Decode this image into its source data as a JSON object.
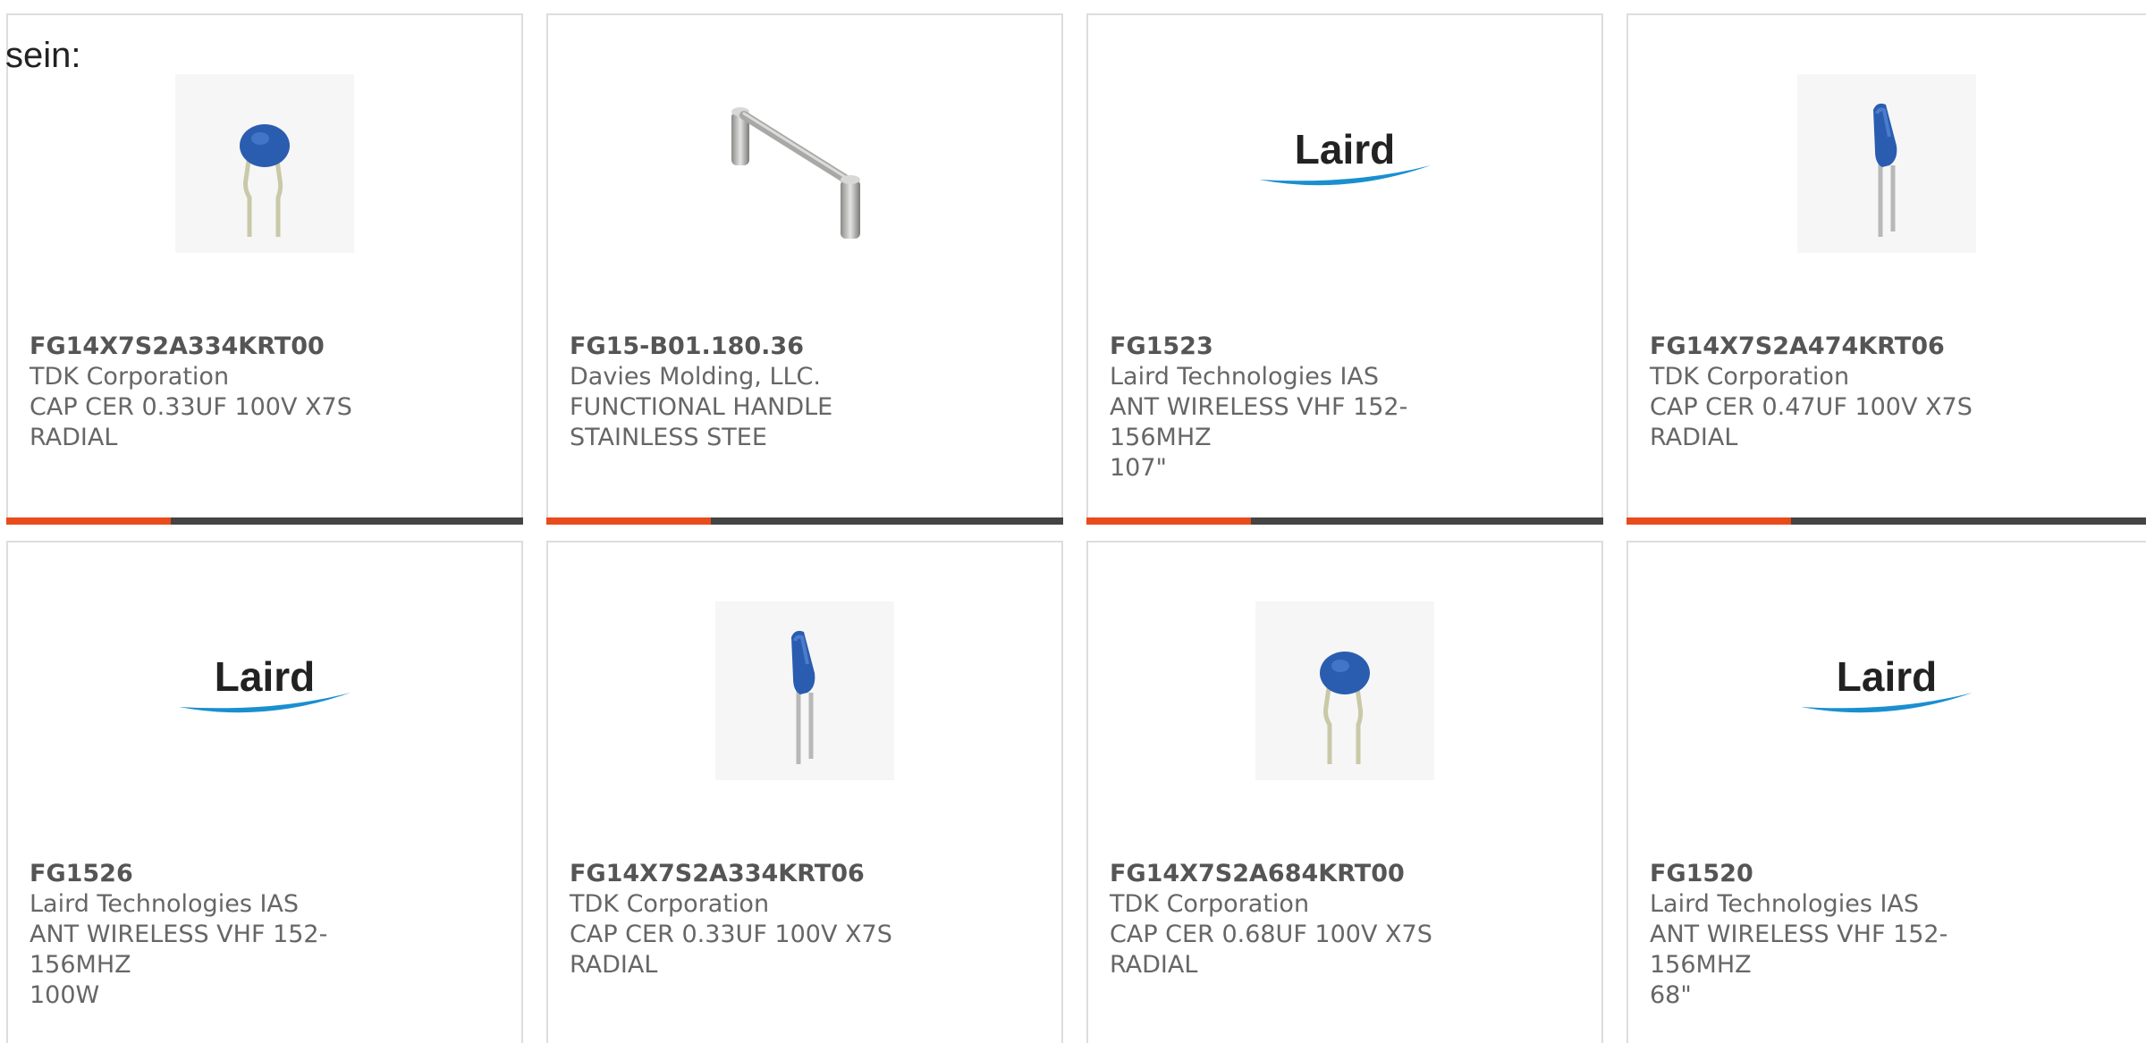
{
  "intro_text": "sein:",
  "colors": {
    "accent": "#e84b1c",
    "bar": "#444444",
    "capacitor_blue": "#2a5db0",
    "laird_blue": "#1a8fd0"
  },
  "products": [
    {
      "part_number": "FG14X7S2A334KRT00",
      "manufacturer": "TDK Corporation",
      "description_line1": "CAP CER 0.33UF 100V X7S",
      "description_line2": "RADIAL",
      "image_icon": "capacitor-bent-icon"
    },
    {
      "part_number": "FG15-B01.180.36",
      "manufacturer": "Davies Molding, LLC.",
      "description_line1": "FUNCTIONAL HANDLE",
      "description_line2": "STAINLESS STEE",
      "image_icon": "handle-icon"
    },
    {
      "part_number": "FG1523",
      "manufacturer": "Laird Technologies IAS",
      "description_line1": "ANT WIRELESS VHF 152-156MHZ",
      "description_line2": "107\"",
      "image_icon": "laird-logo",
      "logo_text": "Laird"
    },
    {
      "part_number": "FG14X7S2A474KRT06",
      "manufacturer": "TDK Corporation",
      "description_line1": "CAP CER 0.47UF 100V X7S",
      "description_line2": "RADIAL",
      "image_icon": "capacitor-straight-icon"
    },
    {
      "part_number": "FG1526",
      "manufacturer": "Laird Technologies IAS",
      "description_line1": "ANT WIRELESS VHF 152-156MHZ",
      "description_line2": "100W",
      "image_icon": "laird-logo",
      "logo_text": "Laird"
    },
    {
      "part_number": "FG14X7S2A334KRT06",
      "manufacturer": "TDK Corporation",
      "description_line1": "CAP CER 0.33UF 100V X7S",
      "description_line2": "RADIAL",
      "image_icon": "capacitor-straight-icon"
    },
    {
      "part_number": "FG14X7S2A684KRT00",
      "manufacturer": "TDK Corporation",
      "description_line1": "CAP CER 0.68UF 100V X7S",
      "description_line2": "RADIAL",
      "image_icon": "capacitor-bent-icon"
    },
    {
      "part_number": "FG1520",
      "manufacturer": "Laird Technologies IAS",
      "description_line1": "ANT WIRELESS VHF 152-156MHZ",
      "description_line2": "68\"",
      "image_icon": "laird-logo",
      "logo_text": "Laird"
    }
  ]
}
